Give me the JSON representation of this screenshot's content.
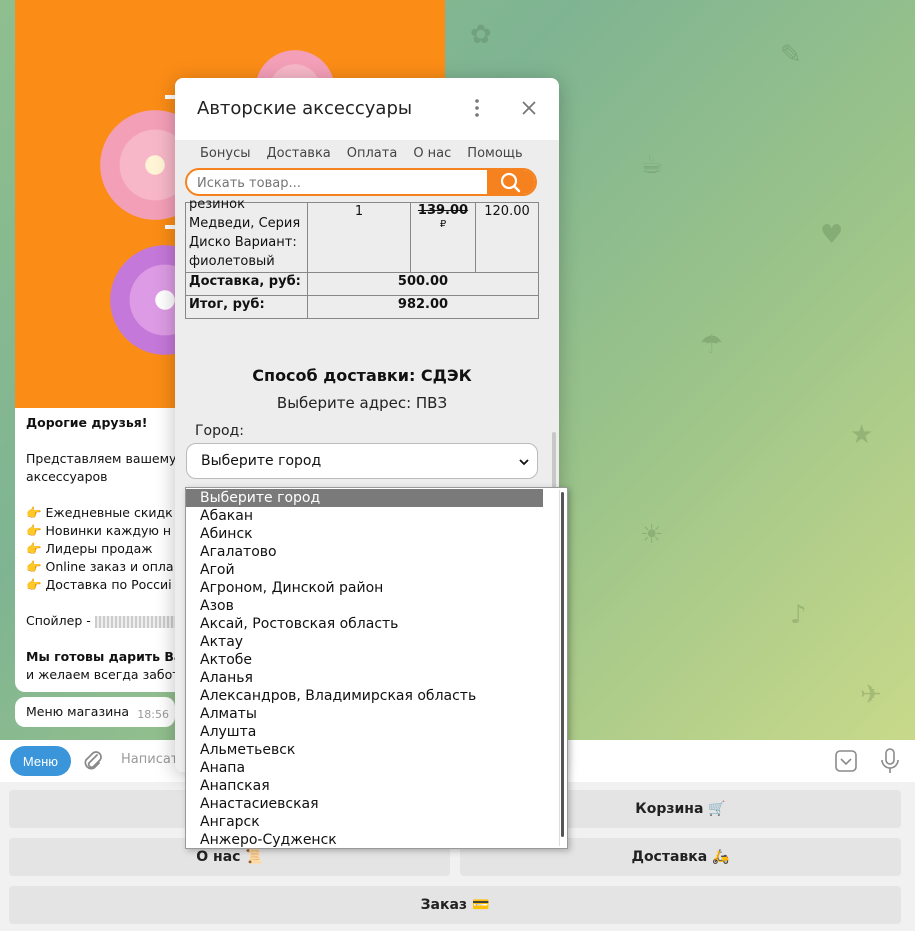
{
  "chat": {
    "message_lines": [
      "Дорогие друзья!",
      "",
      "Представляем вашему в",
      "аксессуаров",
      "",
      "👉 Ежедневные скидк",
      "👉 Новинки каждую н",
      "👉 Лидеры продаж",
      "👉 Online заказ и опла",
      "👉 Доставка по Россиі",
      "",
      "Спойлер - ",
      "",
      "Мы готовы дарить Ва",
      "и желаем всегда забот"
    ],
    "menu_bubble": {
      "text": "Меню магазина",
      "time": "18:56"
    }
  },
  "composer": {
    "menu_button": "Меню",
    "placeholder": "Написать"
  },
  "keyboard": {
    "cart": "Корзина 🛒",
    "about": "О нас 📜",
    "delivery": "Доставка 🛵",
    "order": "Заказ 💳"
  },
  "modal": {
    "title": "Авторские аксессуары",
    "nav": [
      "Бонусы",
      "Доставка",
      "Оплата",
      "О нас",
      "Помощь"
    ],
    "search_placeholder": "Искать товар...",
    "item": {
      "name_lines": [
        "резинок",
        "Медведи, Серия",
        "Диско Вариант:",
        "фиолетовый"
      ],
      "qty": "1",
      "old_price": "139.00",
      "currency": "₽",
      "price": "120.00"
    },
    "delivery_label": "Доставка, руб:",
    "delivery_value": "500.00",
    "total_label": "Итог, руб:",
    "total_value": "982.00",
    "shipping_title": "Способ доставки: СДЭК",
    "shipping_sub": "Выберите адрес: ПВЗ",
    "city_label": "Город:",
    "city_select": "Выберите город"
  },
  "city_options": [
    "Выберите город",
    "Абакан",
    "Абинск",
    "Агалатово",
    "Агой",
    "Агроном, Динской район",
    "Азов",
    "Аксай, Ростовская область",
    "Актау",
    "Актобе",
    "Аланья",
    "Александров, Владимирская область",
    "Алматы",
    "Алушта",
    "Альметьевск",
    "Анапа",
    "Анапская",
    "Анастасиевская",
    "Ангарск",
    "Анжеро-Судженск"
  ],
  "colors": {
    "accent": "#f5821f",
    "menu_button": "#3a95db",
    "selected_option": "#7a7a7a"
  }
}
